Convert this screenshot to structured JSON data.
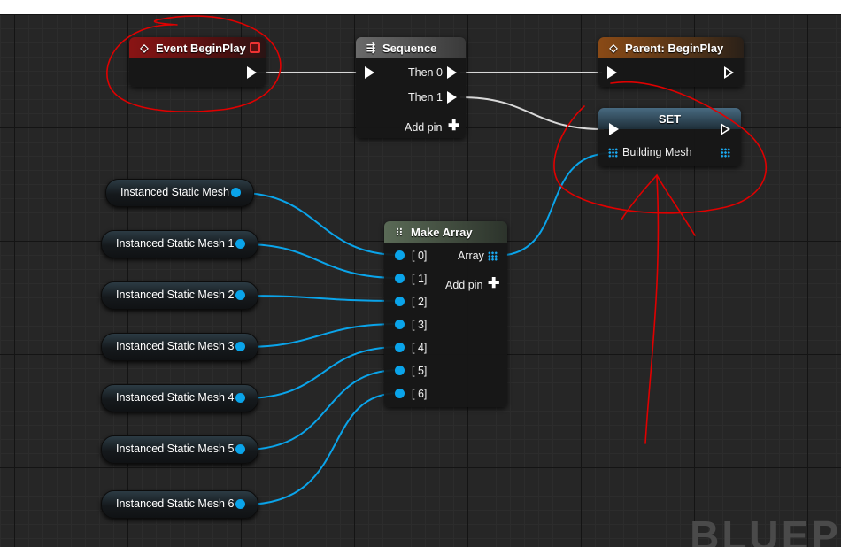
{
  "nodes": {
    "event_begin_play": {
      "title": "Event BeginPlay"
    },
    "sequence": {
      "title": "Sequence",
      "then0": "Then 0",
      "then1": "Then 1",
      "add_pin": "Add pin"
    },
    "parent_begin_play": {
      "title": "Parent: BeginPlay"
    },
    "set": {
      "title": "SET",
      "var_label": "Building Mesh"
    },
    "make_array": {
      "title": "Make Array",
      "inputs": [
        "[ 0]",
        "[ 1]",
        "[ 2]",
        "[ 3]",
        "[ 4]",
        "[ 5]",
        "[ 6]"
      ],
      "output": "Array",
      "add_pin": "Add pin"
    }
  },
  "variables": [
    "Instanced Static Mesh",
    "Instanced Static Mesh 1",
    "Instanced Static Mesh 2",
    "Instanced Static Mesh 3",
    "Instanced Static Mesh 4",
    "Instanced Static Mesh 5",
    "Instanced Static Mesh 6"
  ],
  "watermark": "BLUEP",
  "colors": {
    "event_header": "#7a1111",
    "sequence_header": "#5f5f5f",
    "parent_header": "#7a4314",
    "set_header": "#2f4a5a",
    "make_array_header": "#4d5b4a",
    "object_pin": "#0aa4ea",
    "annotation": "#e00000"
  }
}
